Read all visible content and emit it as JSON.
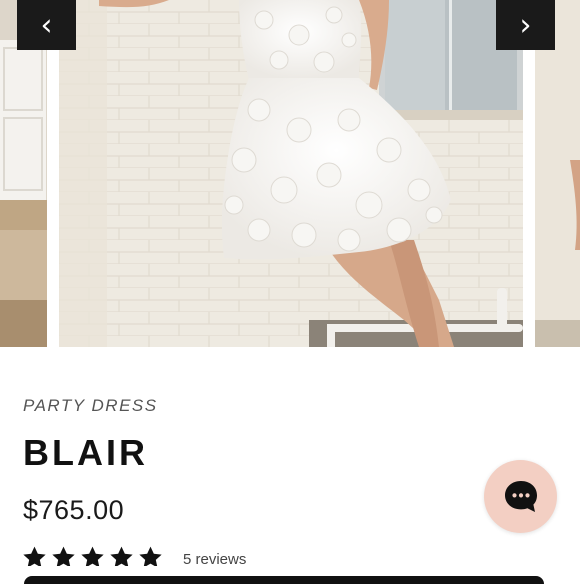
{
  "carousel": {
    "prev_arrow": "‹",
    "next_arrow": "›",
    "image_alt": "White floral mini party dress"
  },
  "product": {
    "category": "PARTY DRESS",
    "name": "BLAIR",
    "price": "$765.00",
    "rating": 5,
    "reviews_label": "5 reviews"
  },
  "chat": {
    "icon": "chat-bubble-icon"
  },
  "colors": {
    "nav_button_bg": "#1a1a1a",
    "chat_bubble_bg": "#f3cfc3",
    "star": "#111111",
    "text_primary": "#111111"
  }
}
